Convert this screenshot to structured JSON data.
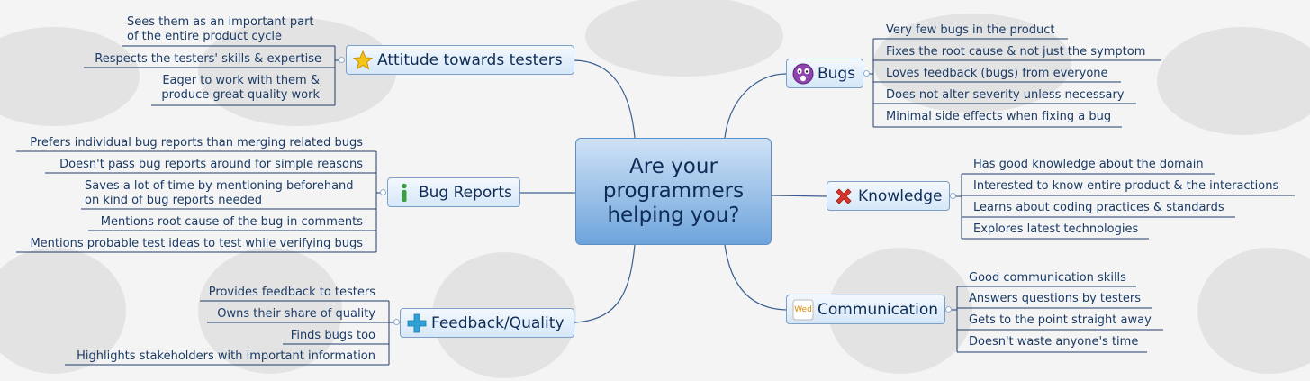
{
  "center": {
    "title": "Are your\nprogrammers\nhelping you?"
  },
  "topics": {
    "attitude": {
      "label": "Attitude towards testers",
      "icon": "star-icon",
      "items": [
        "Sees them as an important part\nof the entire product cycle",
        "Respects the testers' skills & expertise",
        "Eager to work with them &\nproduce great quality work"
      ]
    },
    "bug_reports": {
      "label": "Bug Reports",
      "icon": "info-icon",
      "items": [
        "Prefers individual bug reports than merging related bugs",
        "Doesn't pass bug reports around for simple reasons",
        "Saves a lot of time by mentioning beforehand\non kind of bug reports needed",
        "Mentions root cause of the bug in comments",
        "Mentions probable test ideas to test while verifying bugs"
      ]
    },
    "feedback": {
      "label": "Feedback/Quality",
      "icon": "plus-icon",
      "items": [
        "Provides feedback to testers",
        "Owns their share of quality",
        "Finds bugs too",
        "Highlights stakeholders with important information"
      ]
    },
    "bugs": {
      "label": "Bugs",
      "icon": "shocked-face-icon",
      "items": [
        "Very few bugs in the product",
        "Fixes the root cause & not just the symptom",
        "Loves feedback (bugs) from everyone",
        "Does not alter severity unless necessary",
        "Minimal side effects when fixing a bug"
      ]
    },
    "knowledge": {
      "label": "Knowledge",
      "icon": "cross-icon",
      "items": [
        "Has good knowledge about the domain",
        "Interested to know entire product & the interactions",
        "Learns about coding practices & standards",
        "Explores latest technologies"
      ]
    },
    "communication": {
      "label": "Communication",
      "icon": "calendar-wed-icon",
      "icon_text": "Wed",
      "items": [
        "Good communication skills",
        "Answers questions by testers",
        "Gets to the point straight away",
        "Doesn't waste anyone's time"
      ]
    }
  },
  "colors": {
    "line": "#1f3d6b",
    "branch": "#3a5f8f",
    "star": "#f5c518",
    "info": "#3aa040",
    "plus": "#2fa3d9",
    "cross": "#d9362b",
    "face": "#8e44ad"
  }
}
